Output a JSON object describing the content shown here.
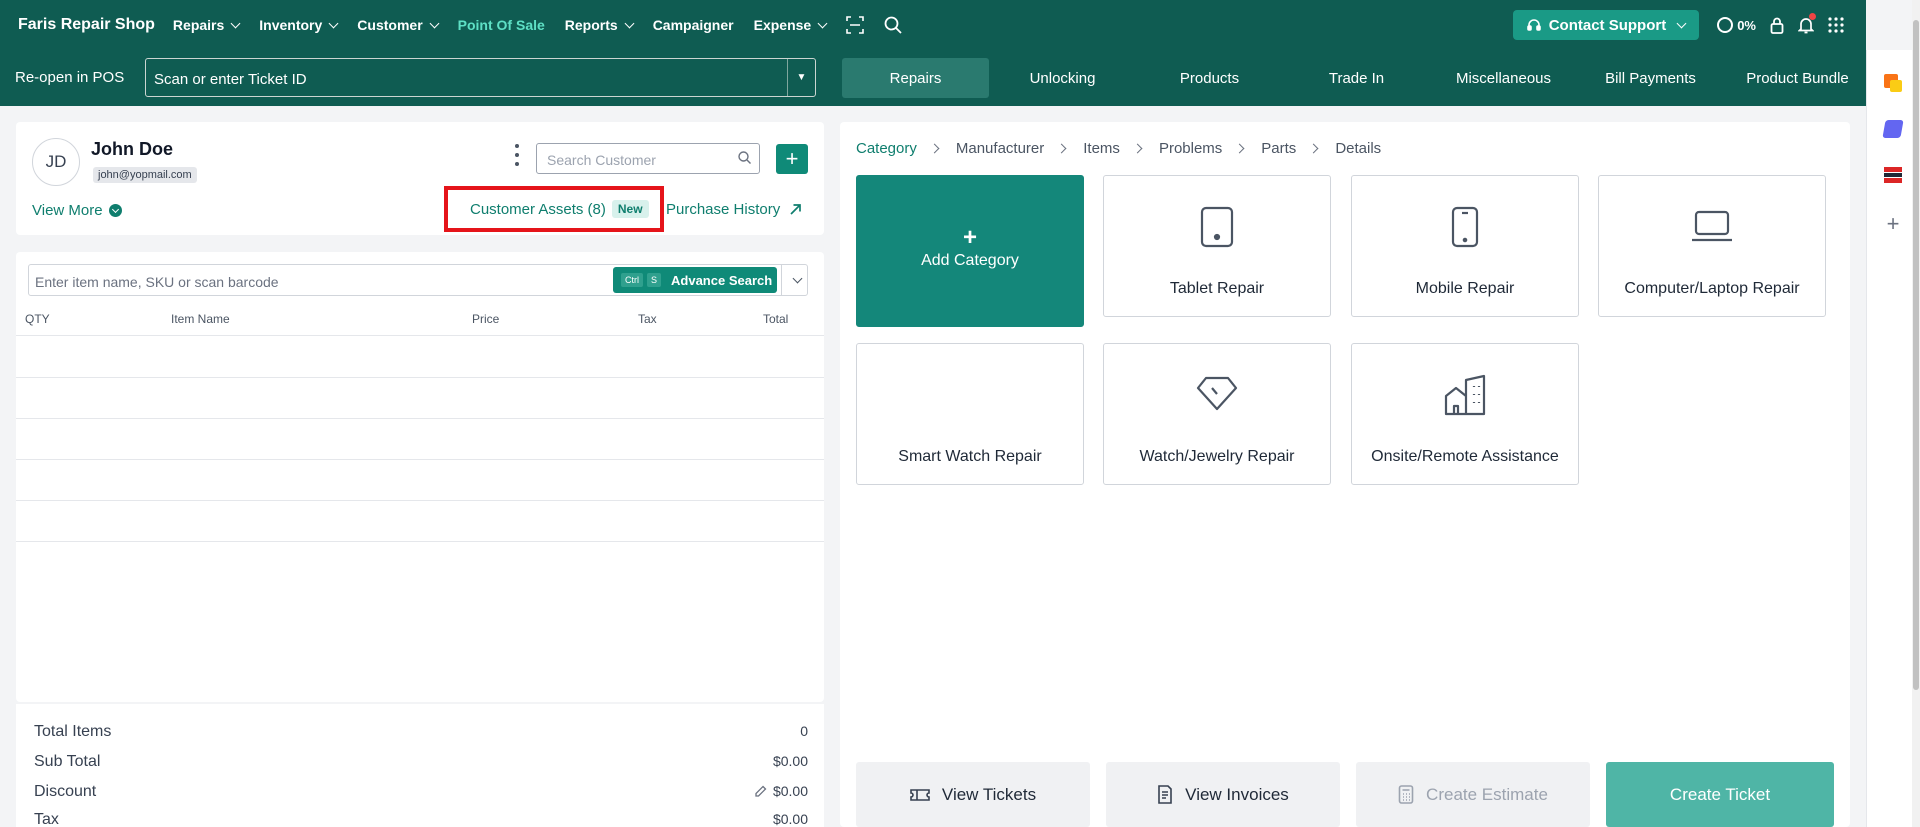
{
  "nav": {
    "brand": "Faris Repair Shop",
    "items": [
      {
        "label": "Repairs",
        "dropdown": true
      },
      {
        "label": "Inventory",
        "dropdown": true
      },
      {
        "label": "Customer",
        "dropdown": true
      },
      {
        "label": "Point Of Sale",
        "dropdown": false,
        "active": true
      },
      {
        "label": "Reports",
        "dropdown": true
      },
      {
        "label": "Campaigner",
        "dropdown": false
      },
      {
        "label": "Expense",
        "dropdown": true
      }
    ],
    "contact_support": "Contact Support",
    "progress": "0%",
    "colors": {
      "bar": "#0f5c52",
      "accent": "#14877a",
      "active_link": "#5ee0c5"
    }
  },
  "pos_bar": {
    "reopen_label": "Re-open in POS",
    "ticket_placeholder": "Scan or enter Ticket ID",
    "tabs": [
      "Repairs",
      "Unlocking",
      "Products",
      "Trade In",
      "Miscellaneous",
      "Bill Payments",
      "Product Bundle"
    ],
    "active_tab": "Repairs"
  },
  "customer": {
    "initials": "JD",
    "name": "John Doe",
    "email": "john@yopmail.com",
    "search_placeholder": "Search Customer",
    "view_more": "View More",
    "assets_label": "Customer Assets (8)",
    "new_badge": "New",
    "purchase_history": "Purchase History"
  },
  "items": {
    "search_placeholder": "Enter item name, SKU or scan barcode",
    "kbd_ctrl": "Ctrl",
    "kbd_s": "S",
    "advance_search": "Advance Search",
    "columns": [
      "QTY",
      "Item Name",
      "Price",
      "Tax",
      "Total"
    ]
  },
  "totals": {
    "total_items_label": "Total Items",
    "total_items": "0",
    "sub_total_label": "Sub Total",
    "sub_total": "$0.00",
    "discount_label": "Discount",
    "discount": "$0.00",
    "tax_label": "Tax",
    "tax": "$0.00"
  },
  "repairs": {
    "breadcrumb": [
      "Category",
      "Manufacturer",
      "Items",
      "Problems",
      "Parts",
      "Details"
    ],
    "add_category": "Add Category",
    "categories": [
      {
        "label": "Tablet Repair",
        "icon": "tablet-icon"
      },
      {
        "label": "Mobile Repair",
        "icon": "mobile-icon"
      },
      {
        "label": "Computer/Laptop Repair",
        "icon": "laptop-icon"
      },
      {
        "label": "Smart Watch Repair",
        "icon": ""
      },
      {
        "label": "Watch/Jewelry Repair",
        "icon": "diamond-icon"
      },
      {
        "label": "Onsite/Remote Assistance",
        "icon": "building-icon"
      }
    ]
  },
  "actions": {
    "view_tickets": "View Tickets",
    "view_invoices": "View Invoices",
    "create_estimate": "Create Estimate",
    "create_ticket": "Create Ticket"
  }
}
